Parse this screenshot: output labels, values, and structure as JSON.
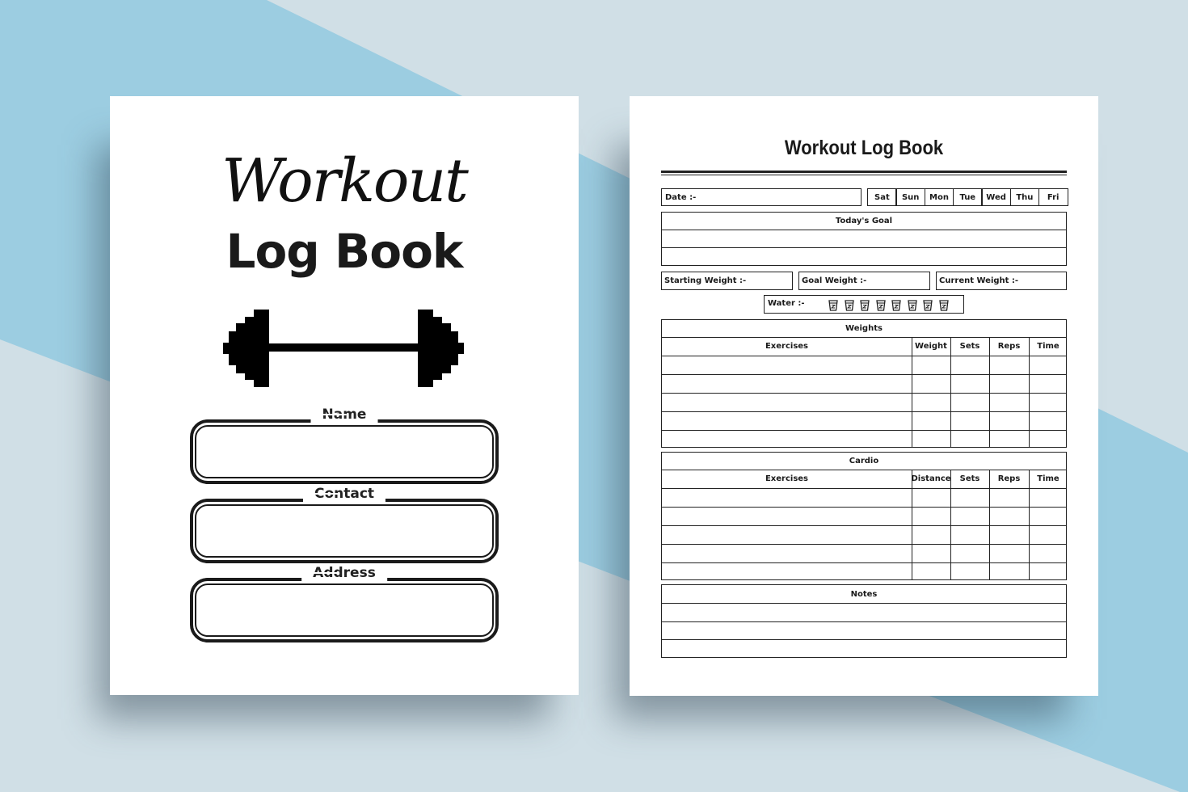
{
  "colors": {
    "background_light": "#d0dfe6",
    "background_band": "#9ccde1",
    "page": "#ffffff",
    "ink": "#1a1a1a"
  },
  "cover": {
    "script_title": "Workout",
    "title": "Log Book",
    "icon": "barbell-icon",
    "fields": [
      {
        "label": "Name"
      },
      {
        "label": "Contact"
      },
      {
        "label": "Address"
      }
    ]
  },
  "log_page": {
    "title": "Workout Log Book",
    "date_label": "Date :-",
    "days": [
      "Sat",
      "Sun",
      "Mon",
      "Tue",
      "Wed",
      "Thu",
      "Fri"
    ],
    "todays_goal": {
      "heading": "Today's Goal",
      "blank_lines": 2
    },
    "weights_row": [
      "Starting Weight :-",
      "Goal Weight :-",
      "Current Weight :-"
    ],
    "water": {
      "label": "Water :-",
      "cups": 8,
      "icon": "water-cup-icon"
    },
    "weights": {
      "heading": "Weights",
      "columns": [
        "Exercises",
        "Weight",
        "Sets",
        "Reps",
        "Time"
      ],
      "blank_rows": 5
    },
    "cardio": {
      "heading": "Cardio",
      "columns": [
        "Exercises",
        "Distance",
        "Sets",
        "Reps",
        "Time"
      ],
      "blank_rows": 5
    },
    "notes": {
      "heading": "Notes",
      "blank_lines": 3
    }
  }
}
